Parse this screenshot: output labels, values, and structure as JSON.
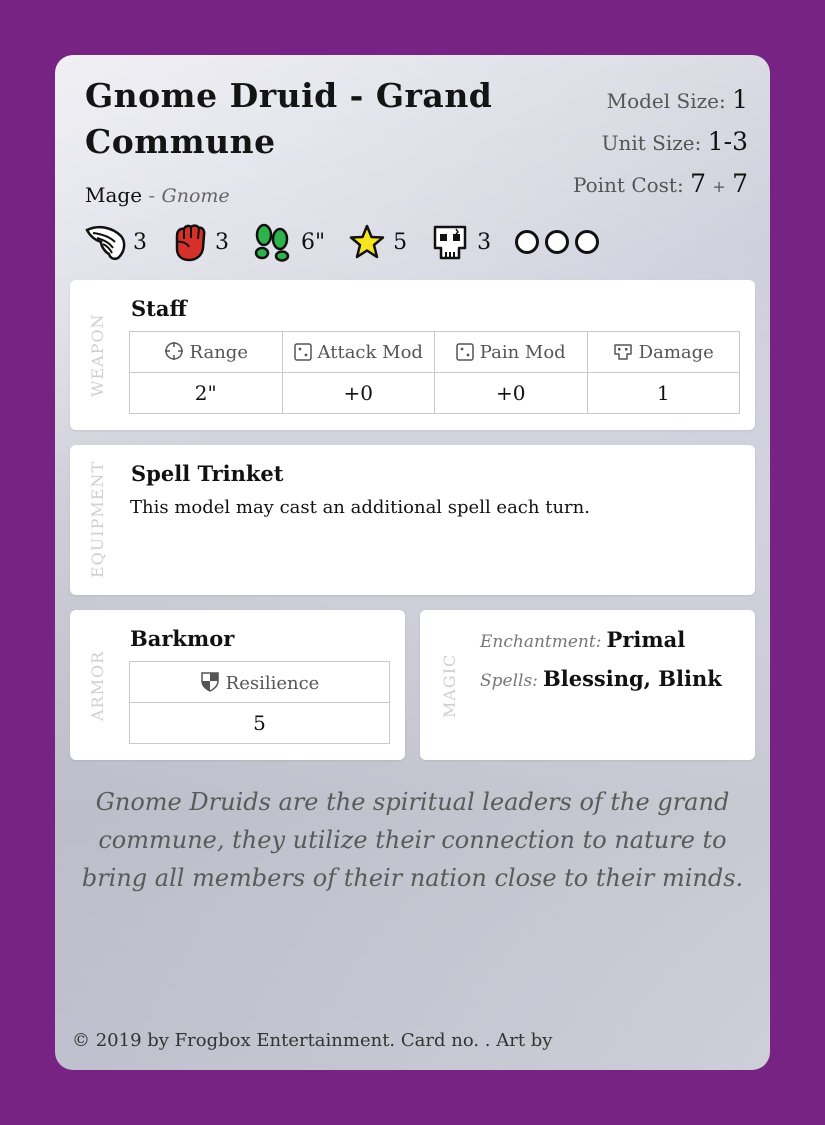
{
  "card": {
    "title": "Gnome Druid - Grand Commune",
    "class": "Mage",
    "separator": "-",
    "faction": "Gnome",
    "model_size_label": "Model Size:",
    "model_size": "1",
    "unit_size_label": "Unit Size:",
    "unit_size": "1-3",
    "point_cost_label": "Point Cost:",
    "point_cost_base": "7",
    "point_cost_plus": "+",
    "point_cost_extra": "7"
  },
  "stats": [
    {
      "icon": "wing-icon",
      "value": "3"
    },
    {
      "icon": "fist-icon",
      "value": "3"
    },
    {
      "icon": "footprints-icon",
      "value": "6\""
    },
    {
      "icon": "star-icon",
      "value": "5"
    },
    {
      "icon": "skull-icon",
      "value": "3"
    }
  ],
  "wound_circles": 3,
  "weapon": {
    "section_label": "WEAPON",
    "name": "Staff",
    "headers": [
      "Range",
      "Attack Mod",
      "Pain Mod",
      "Damage"
    ],
    "header_icons": [
      "crosshair-icon",
      "die-icon",
      "die-icon",
      "chip-icon"
    ],
    "values": [
      "2\"",
      "+0",
      "+0",
      "1"
    ]
  },
  "equipment": {
    "section_label": "EQUIPMENT",
    "name": "Spell Trinket",
    "text": "This model may cast an additional spell each turn."
  },
  "armor": {
    "section_label": "ARMOR",
    "name": "Barkmor",
    "header": "Resilience",
    "header_icon": "shield-icon",
    "value": "5"
  },
  "magic": {
    "section_label": "MAGIC",
    "enchantment_label": "Enchantment:",
    "enchantment": "Primal",
    "spells_label": "Spells:",
    "spells": "Blessing, Blink"
  },
  "flavor": "Gnome Druids are the spiritual leaders of the grand commune, they utilize their connection to nature to bring all members of their nation close to their minds.",
  "footer": "© 2019 by Frogbox Entertainment. Card no. . Art by",
  "colors": {
    "background": "#772384",
    "fist": "#d5312a",
    "footprints": "#2fb24a",
    "star": "#f7e51f"
  }
}
